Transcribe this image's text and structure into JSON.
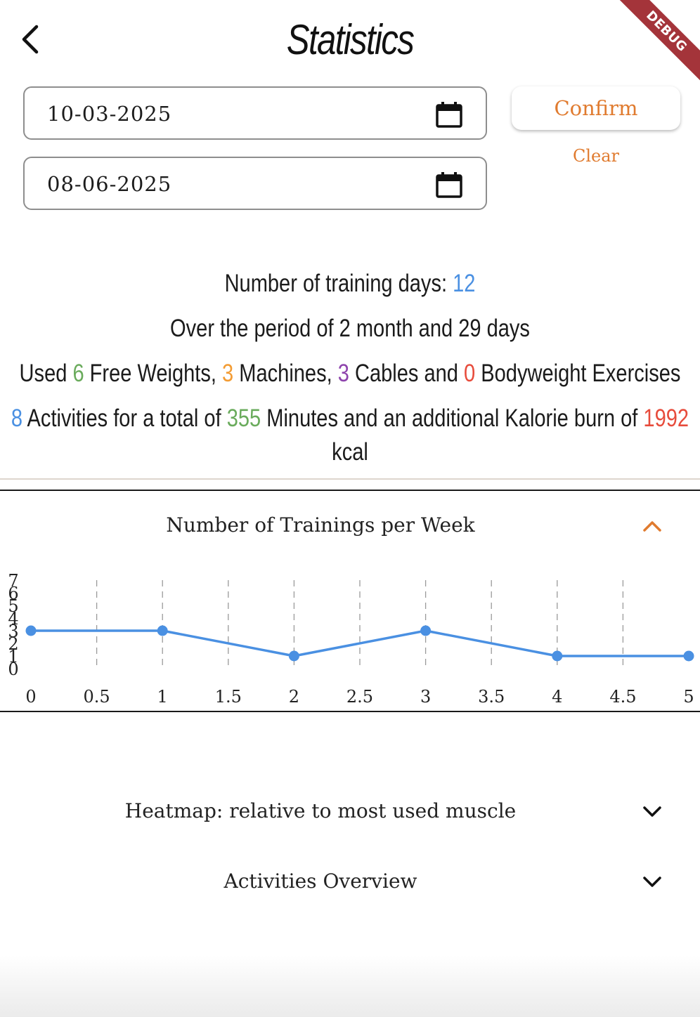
{
  "header": {
    "title": "Statistics",
    "debug_label": "DEBUG"
  },
  "filters": {
    "start_date": "10-03-2025",
    "end_date": "08-06-2025",
    "confirm_label": "Confirm",
    "clear_label": "Clear"
  },
  "summary": {
    "line1": {
      "prefix": "Number of training days: ",
      "days": "12"
    },
    "line2": "Over the period of 2 month and 29 days",
    "line3": {
      "used": "Used ",
      "free_weights": "6",
      "free_weights_label": " Free Weights, ",
      "machines": "3",
      "machines_label": " Machines, ",
      "cables": "3",
      "cables_label": " Cables and ",
      "bodyweight": "0",
      "bodyweight_label": " Bodyweight Exercises"
    },
    "line4": {
      "activities": "8",
      "activities_label": " Activities for a total of ",
      "minutes": "355",
      "minutes_label": " Minutes and an additional Kalorie burn of ",
      "kcal": "1992",
      "kcal_label": " kcal"
    }
  },
  "sections": {
    "trainings_per_week": "Number of Trainings per Week",
    "heatmap": "Heatmap: relative to most used muscle",
    "activities_overview": "Activities Overview"
  },
  "colors": {
    "accent": "#e07b2f",
    "line": "#4a90e2",
    "blue": "#4a90e2",
    "green": "#6aab5c",
    "orange": "#f39c34",
    "purple": "#8e44ad",
    "red": "#e74c3c"
  },
  "chart_data": {
    "type": "line",
    "title": "Number of Trainings per Week",
    "x": [
      0,
      1,
      2,
      3,
      4,
      5
    ],
    "series": [
      {
        "values": [
          3,
          3,
          1,
          3,
          1,
          1
        ]
      }
    ],
    "x_ticks": [
      "0",
      "0.5",
      "1",
      "1.5",
      "2",
      "2.5",
      "3",
      "3.5",
      "4",
      "4.5",
      "5"
    ],
    "y_ticks": [
      "0",
      "1",
      "2",
      "3",
      "4",
      "5",
      "6",
      "7"
    ],
    "xlim": [
      0,
      5
    ],
    "ylim": [
      0,
      7
    ],
    "grid": "vertical dashed"
  }
}
